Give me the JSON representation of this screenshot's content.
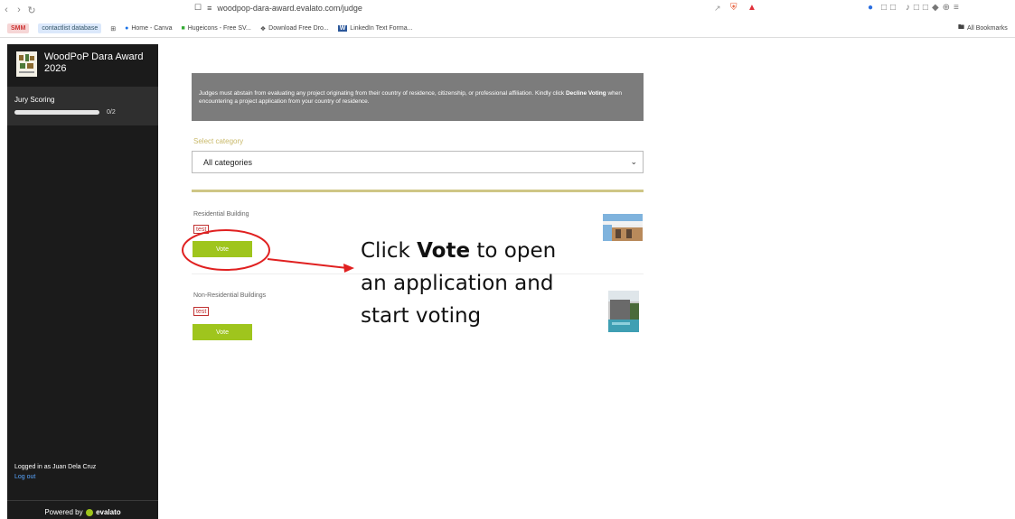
{
  "browser": {
    "url": "woodpop-dara-award.evalato.com/judge",
    "bookmarks": [
      {
        "label": "SMM",
        "style": "badge-red"
      },
      {
        "label": "contactlist database",
        "style": "badge-blue"
      },
      {
        "label": "Home - Canva",
        "style": "plain"
      },
      {
        "label": "Hugeicons - Free SV...",
        "style": "plain"
      },
      {
        "label": "Download Free Dro...",
        "style": "plain"
      },
      {
        "label": "LinkedIn Text Forma...",
        "style": "plain"
      }
    ],
    "all_bookmarks": "All Bookmarks"
  },
  "sidebar": {
    "title": "WoodPoP Dara Award 2026",
    "section": "Jury Scoring",
    "progress": {
      "done": 0,
      "total": 2,
      "text": "0/2"
    },
    "login_text": "Logged in as Juan Dela Cruz",
    "logout": "Log out",
    "powered_by": "Powered by",
    "brand": "evalato"
  },
  "main": {
    "notice": "Judges must abstain from evaluating any project originating from their country of residence, citizenship, or professional affiliation. Kindly click",
    "notice_bold": "Decline Voting",
    "notice_end": "when encountering a project application from your country of residence.",
    "category_label": "Select category",
    "category_value": "All categories",
    "entries": [
      {
        "category": "Residential Building",
        "tag": "test",
        "vote": "Vote"
      },
      {
        "category": "Non-Residential Buildings",
        "tag": "test",
        "vote": "Vote"
      }
    ]
  },
  "callout": {
    "pre": "Click",
    "bold": "Vote",
    "line1_post": "to open",
    "line2": "an application and",
    "line3": "start voting"
  },
  "colors": {
    "sidebar": "#1b1b1b",
    "vote": "#9fc51d",
    "accent_line": "#cfc686",
    "annotation": "#e02020"
  }
}
